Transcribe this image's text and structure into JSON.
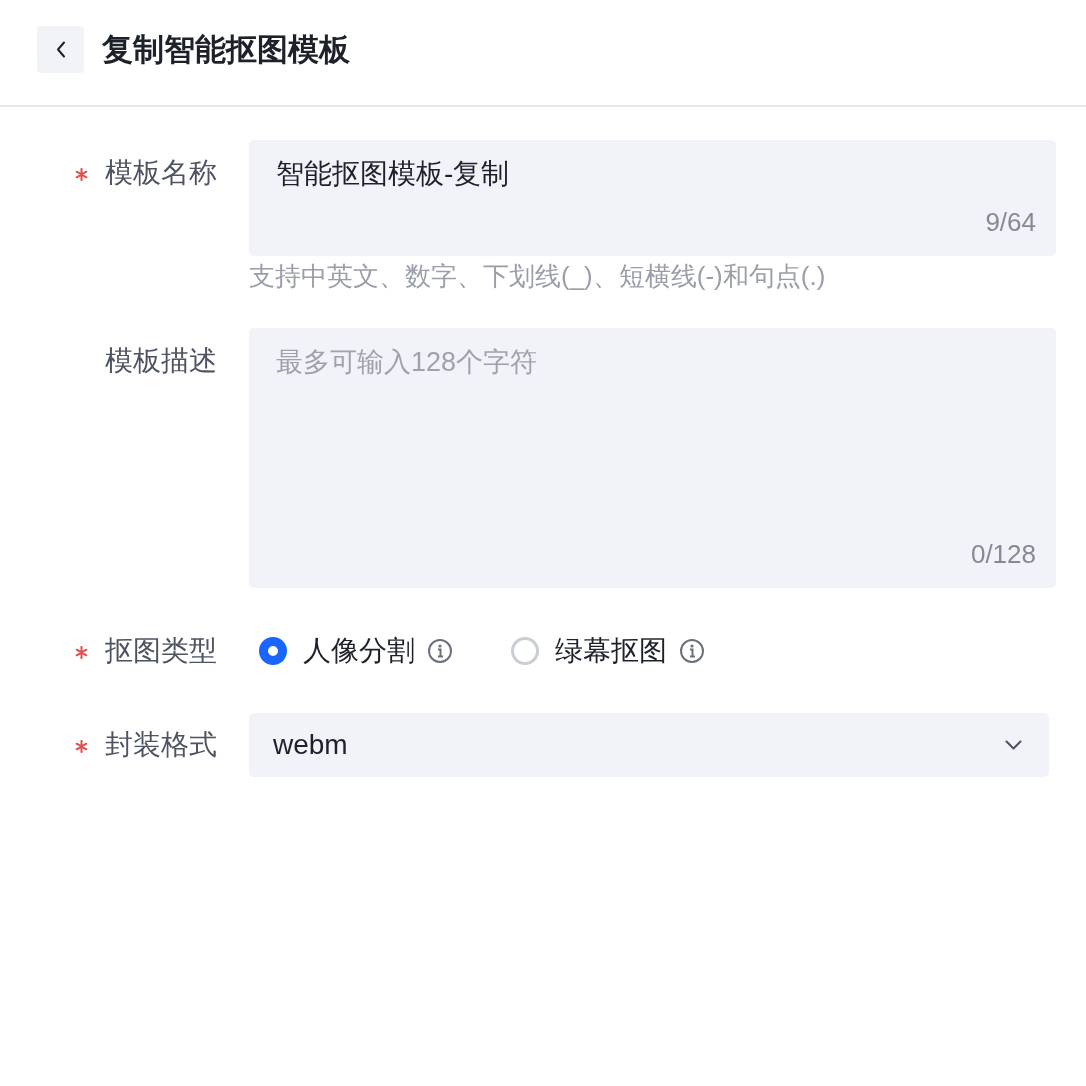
{
  "header": {
    "title": "复制智能抠图模板"
  },
  "form": {
    "fields": [
      {
        "kind": "text",
        "label": "模板名称",
        "required": true,
        "value": "智能抠图模板-复制",
        "counter": "9/64",
        "hint": "支持中英文、数字、下划线(_)、短横线(-)和句点(.)"
      },
      {
        "kind": "textarea",
        "label": "模板描述",
        "required": false,
        "placeholder": "最多可输入128个字符",
        "counter": "0/128"
      },
      {
        "kind": "radio",
        "label": "抠图类型",
        "required": true,
        "options": [
          {
            "label": "人像分割",
            "selected": true
          },
          {
            "label": "绿幕抠图",
            "selected": false
          }
        ]
      },
      {
        "kind": "select",
        "label": "封装格式",
        "required": true,
        "value": "webm"
      }
    ]
  }
}
